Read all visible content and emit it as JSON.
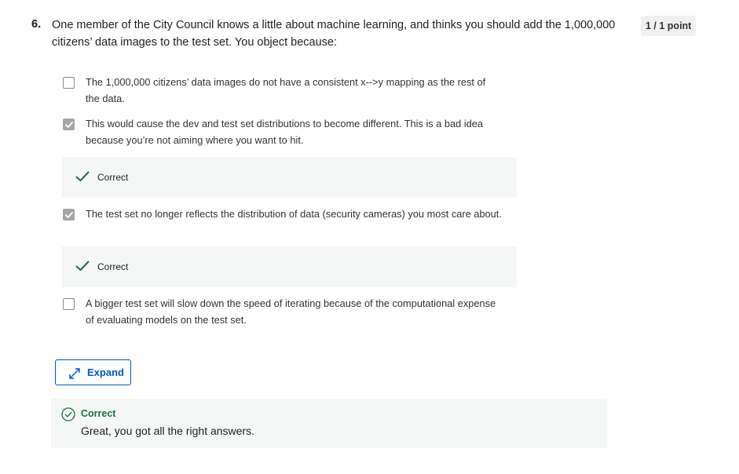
{
  "question": {
    "number": "6.",
    "text": "One member of the City Council knows a little about machine learning, and thinks you should add the 1,000,000 citizens’ data images to the test set. You object because:",
    "points": "1 / 1 point"
  },
  "options": [
    {
      "text": "The 1,000,000 citizens’ data images do not have a consistent x-->y mapping as the rest of the data.",
      "checked": false
    },
    {
      "text": "This would cause the dev and test set distributions to become different. This is a bad idea because you’re not aiming where you want to hit.",
      "checked": true,
      "feedback": "Correct"
    },
    {
      "text": "The test set no longer reflects the distribution of data (security cameras) you most care about.",
      "checked": true,
      "feedback": "Correct"
    },
    {
      "text": "A bigger test set will slow down the speed of iterating because of the computational expense of evaluating models on the test set.",
      "checked": false
    }
  ],
  "expand_button": {
    "label": "Expand"
  },
  "result": {
    "title": "Correct",
    "message": "Great, you got all the right answers."
  },
  "colors": {
    "accent_blue": "#0056d2",
    "success_green": "#1f6e43",
    "feedback_bg": "#f4f7f5",
    "checked_gray": "#a6a6a6"
  },
  "icons": {
    "checkbox_check": "check-icon",
    "feedback_check": "green-check-icon",
    "expand": "expand-arrows-icon",
    "result": "circle-check-icon"
  }
}
